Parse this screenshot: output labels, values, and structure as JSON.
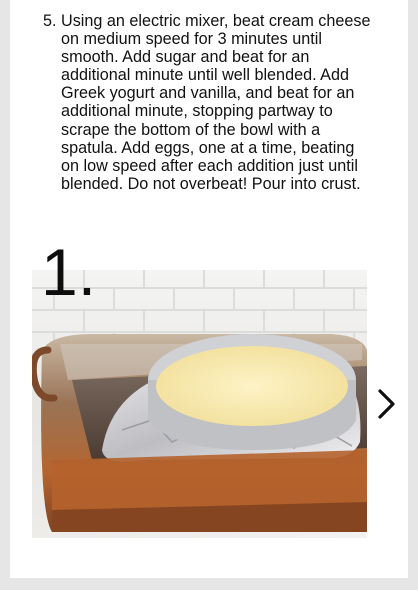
{
  "step": {
    "number": "5.",
    "text": "Using an electric mixer, beat cream cheese on medium speed for 3 minutes until smooth. Add sugar and beat for an additional minute until well blended. Add Greek yogurt and vanilla, and beat for an additional minute, stopping partway to scrape the bottom of the bowl with a spatula. Add eggs, one at a time, beating on low speed after each addition just until blended. Do not overbeat! Pour into crust."
  },
  "slideshow": {
    "index_label": "1.",
    "next_icon": "chevron-right-icon"
  },
  "colors": {
    "page_bg": "#e6e6e6",
    "card_bg": "#ffffff",
    "text": "#111111"
  }
}
